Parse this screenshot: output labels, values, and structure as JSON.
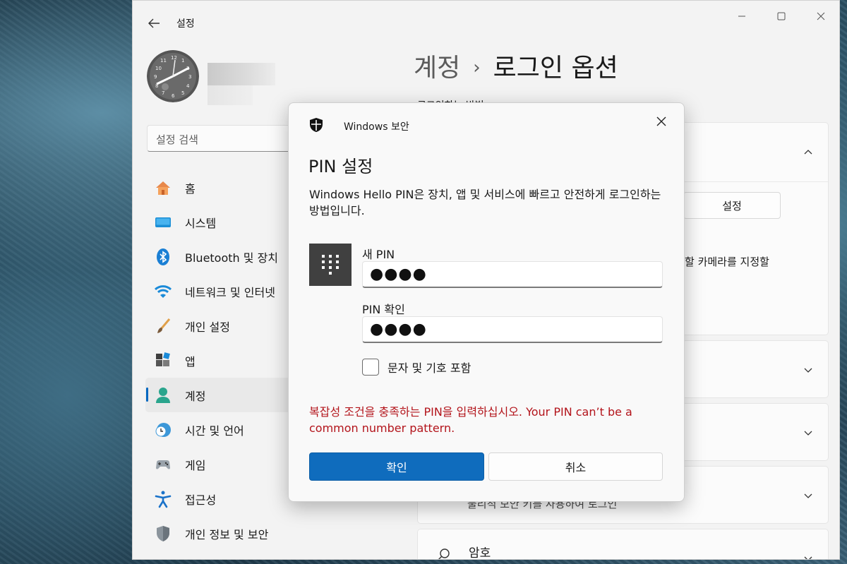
{
  "window": {
    "title": "설정",
    "accent_color": "#0067c0"
  },
  "search": {
    "placeholder": "설정 검색"
  },
  "sidebar": {
    "items": [
      {
        "label": "홈",
        "icon": "home-icon"
      },
      {
        "label": "시스템",
        "icon": "system-icon"
      },
      {
        "label": "Bluetooth 및 장치",
        "icon": "bluetooth-icon"
      },
      {
        "label": "네트워크 및 인터넷",
        "icon": "wifi-icon"
      },
      {
        "label": "개인 설정",
        "icon": "brush-icon"
      },
      {
        "label": "앱",
        "icon": "apps-icon"
      },
      {
        "label": "계정",
        "icon": "account-icon",
        "selected": true
      },
      {
        "label": "시간 및 언어",
        "icon": "time-language-icon"
      },
      {
        "label": "게임",
        "icon": "gamepad-icon"
      },
      {
        "label": "접근성",
        "icon": "accessibility-icon"
      },
      {
        "label": "개인 정보 및 보안",
        "icon": "shield-icon"
      }
    ]
  },
  "header": {
    "crumb": "계정",
    "separator": "›",
    "current": "로그인 옵션"
  },
  "background": {
    "section_label": "로그인하는 방법",
    "setup_button": "설정",
    "camera_text": "할 카메라를 지정할",
    "partial_text": "물리적 보안 키를 사용하여 로그인",
    "password_label": "암호"
  },
  "dialog": {
    "app_name": "Windows 보안",
    "title": "PIN 설정",
    "description": "Windows Hello PIN은 장치, 앱 및 서비스에 빠르고 안전하게 로그인하는 방법입니다.",
    "new_pin_label": "새 PIN",
    "new_pin_value": "●●●●",
    "confirm_pin_label": "PIN 확인",
    "confirm_pin_value": "●●●●",
    "checkbox_label": "문자 및 기호 포함",
    "checkbox_checked": false,
    "error": "복잡성 조건을 충족하는 PIN을 입력하십시오. Your PIN can’t be a common number pattern.",
    "error_color": "#b3141b",
    "ok_button": "확인",
    "cancel_button": "취소",
    "primary_color": "#0f6cbd"
  }
}
